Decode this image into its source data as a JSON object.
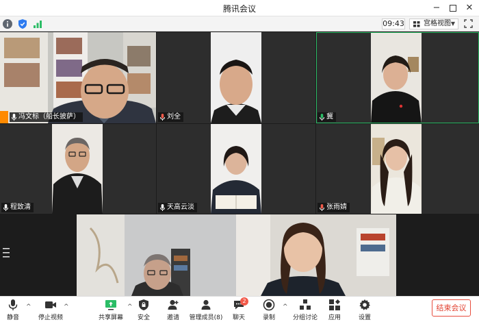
{
  "window": {
    "title": "腾讯会议"
  },
  "toolbar": {
    "time": "09:43",
    "view_label": "宫格视图"
  },
  "participants": [
    {
      "name": "冯文标（船长披萨）"
    },
    {
      "name": "刘全"
    },
    {
      "name": "冀"
    },
    {
      "name": "程致清"
    },
    {
      "name": "天高云淡"
    },
    {
      "name": "张雨婧"
    }
  ],
  "controls": {
    "mute": "静音",
    "stop_video": "停止视频",
    "share": "共享屏幕",
    "security": "安全",
    "invite": "邀请",
    "members": "管理成员(8)",
    "chat": "聊天",
    "chat_badge": "2",
    "record": "录制",
    "breakout": "分组讨论",
    "apps": "应用",
    "settings": "设置",
    "end": "结束会议"
  },
  "colors": {
    "accent": "#2bbd66",
    "end": "#e2402f",
    "host_badge": "#ff8a00"
  }
}
